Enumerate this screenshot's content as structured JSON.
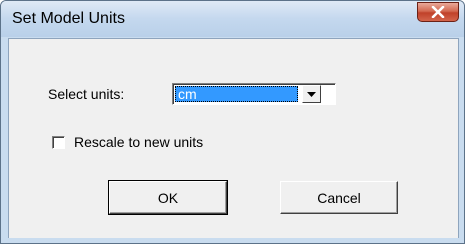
{
  "window": {
    "title": "Set Model Units",
    "close_icon": "close-x-icon"
  },
  "form": {
    "units_label": "Select units:",
    "units_selected": "cm",
    "dropdown_icon": "chevron-down-icon",
    "rescale_label": "Rescale to new units",
    "rescale_checked": false
  },
  "buttons": {
    "ok_label": "OK",
    "cancel_label": "Cancel"
  },
  "colors": {
    "selection": "#3399ff",
    "close_button": "#c0412a",
    "dialog_background": "#f0f0f0"
  }
}
